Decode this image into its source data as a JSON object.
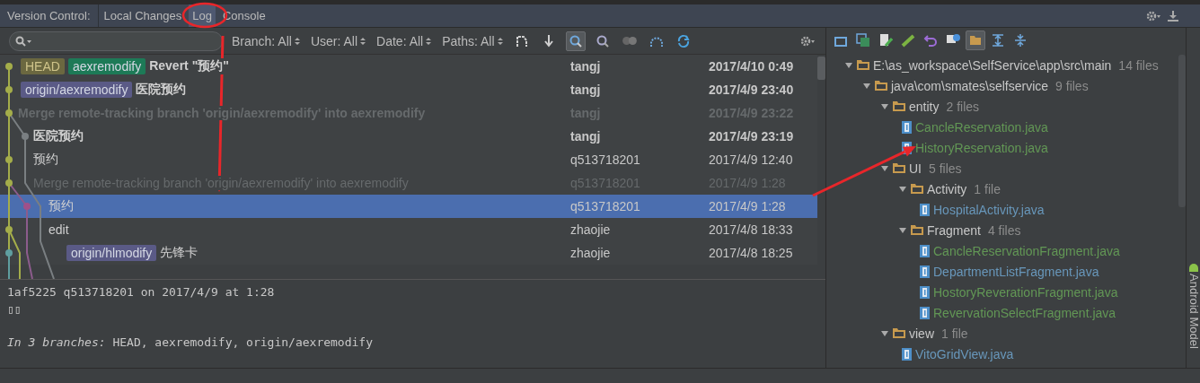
{
  "tool_window": {
    "label": "Version Control:",
    "tabs": [
      {
        "label": "Local Changes",
        "selected": false
      },
      {
        "label": "Log",
        "selected": true
      },
      {
        "label": "Console",
        "selected": false
      }
    ]
  },
  "filters": [
    "Branch: All",
    "User: All",
    "Date: All",
    "Paths: All"
  ],
  "log": {
    "rows": [
      {
        "refs": [
          {
            "kind": "head",
            "label": "HEAD"
          },
          {
            "kind": "local",
            "label": "aexremodify"
          }
        ],
        "message": "Revert \"预约\"",
        "author": "tangj",
        "date": "2017/4/10 0:49",
        "bold": true,
        "dimmed": false,
        "selected": false
      },
      {
        "refs": [
          {
            "kind": "remote",
            "label": "origin/aexremodify"
          }
        ],
        "message": "医院预约",
        "author": "tangj",
        "date": "2017/4/9 23:40",
        "bold": true,
        "dimmed": false,
        "selected": false
      },
      {
        "refs": [],
        "message": "Merge remote-tracking branch 'origin/aexremodify' into aexremodify",
        "author": "tangj",
        "date": "2017/4/9 23:22",
        "bold": true,
        "dimmed": true,
        "selected": false
      },
      {
        "refs": [],
        "message": "医院预约",
        "author": "tangj",
        "date": "2017/4/9 23:19",
        "bold": true,
        "dimmed": false,
        "selected": false
      },
      {
        "refs": [],
        "message": "预约",
        "author": "q513718201",
        "date": "2017/4/9 12:40",
        "bold": false,
        "dimmed": false,
        "selected": false
      },
      {
        "refs": [],
        "message": "Merge remote-tracking branch 'origin/aexremodify' into aexremodify",
        "author": "q513718201",
        "date": "2017/4/9 1:28",
        "bold": false,
        "dimmed": true,
        "selected": false
      },
      {
        "refs": [],
        "message": "预约",
        "author": "q513718201",
        "date": "2017/4/9 1:28",
        "bold": false,
        "dimmed": false,
        "selected": true
      },
      {
        "refs": [],
        "message": "edit",
        "author": "zhaojie",
        "date": "2017/4/8 18:33",
        "bold": false,
        "dimmed": false,
        "selected": false
      },
      {
        "refs": [
          {
            "kind": "remote",
            "label": "origin/hlmodify"
          }
        ],
        "message": "先锋卡",
        "author": "zhaojie",
        "date": "2017/4/8 18:25",
        "bold": false,
        "dimmed": false,
        "selected": false
      }
    ]
  },
  "details": {
    "header": "1af5225 q513718201 on 2017/4/9 at 1:28",
    "message": "▯▯",
    "branches": "*In 3 branches:* HEAD, aexremodify, origin/aexremodify"
  },
  "changes_tree": [
    {
      "kind": "folder",
      "name": "E:\\as_workspace\\SelfService\\app\\src\\main",
      "count": "14 files",
      "expanded": true,
      "children": [
        {
          "kind": "folder",
          "name": "java\\com\\smates\\selfservice",
          "count": "9 files",
          "expanded": true,
          "children": [
            {
              "kind": "folder",
              "name": "entity",
              "count": "2 files",
              "expanded": true,
              "children": [
                {
                  "kind": "file",
                  "name": "CancleReservation.java",
                  "color": "#629755"
                },
                {
                  "kind": "file",
                  "name": "HistoryReservation.java",
                  "color": "#629755"
                }
              ]
            },
            {
              "kind": "folder",
              "name": "UI",
              "count": "5 files",
              "expanded": true,
              "children": [
                {
                  "kind": "folder",
                  "name": "Activity",
                  "count": "1 file",
                  "expanded": true,
                  "children": [
                    {
                      "kind": "file",
                      "name": "HospitalActivity.java",
                      "color": "#6897bb"
                    }
                  ]
                },
                {
                  "kind": "folder",
                  "name": "Fragment",
                  "count": "4 files",
                  "expanded": true,
                  "children": [
                    {
                      "kind": "file",
                      "name": "CancleReservationFragment.java",
                      "color": "#629755"
                    },
                    {
                      "kind": "file",
                      "name": "DepartmentListFragment.java",
                      "color": "#6897bb"
                    },
                    {
                      "kind": "file",
                      "name": "HostoryReverationFragment.java",
                      "color": "#629755"
                    },
                    {
                      "kind": "file",
                      "name": "RevervationSelectFragment.java",
                      "color": "#629755"
                    }
                  ]
                }
              ]
            },
            {
              "kind": "folder",
              "name": "view",
              "count": "1 file",
              "expanded": true,
              "children": [
                {
                  "kind": "file",
                  "name": "VitoGridView.java",
                  "color": "#6897bb"
                }
              ]
            }
          ]
        }
      ]
    }
  ],
  "side_tab": "Android Model"
}
